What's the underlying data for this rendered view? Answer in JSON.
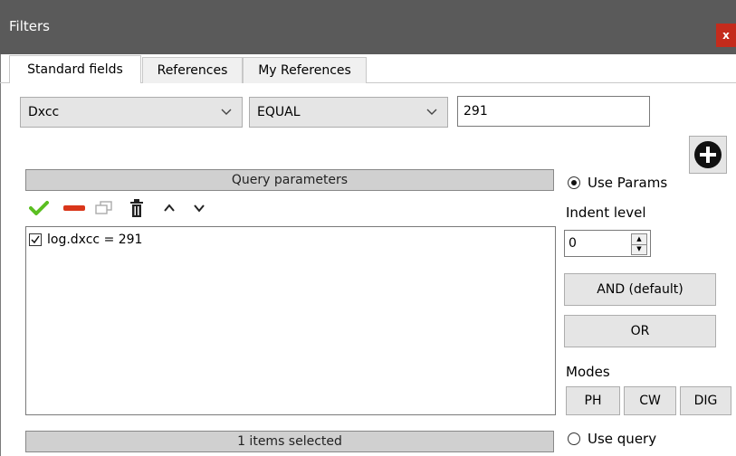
{
  "window": {
    "title": "Filters",
    "close_glyph": "x"
  },
  "tabs": [
    {
      "label": "Standard fields",
      "active": true
    },
    {
      "label": "References",
      "active": false
    },
    {
      "label": "My References",
      "active": false
    }
  ],
  "filter": {
    "field": "Dxcc",
    "operator": "EQUAL",
    "value": "291"
  },
  "query_panel": {
    "header": "Query parameters",
    "toolbar_icons": [
      "check-icon",
      "minus-icon",
      "copy-icon",
      "trash-icon",
      "chevron-up-icon",
      "chevron-down-icon"
    ],
    "items": [
      {
        "text": "log.dxcc = 291",
        "checked": true
      }
    ],
    "status": "1 items selected"
  },
  "options": {
    "use_params_label": "Use Params",
    "use_params_selected": true,
    "indent_label": "Indent level",
    "indent_value": "0",
    "and_label": "AND (default)",
    "or_label": "OR",
    "modes_label": "Modes",
    "mode_buttons": [
      "PH",
      "CW",
      "DIG"
    ],
    "use_query_label": "Use query",
    "use_query_selected": false
  },
  "colors": {
    "titlebar": "#5a5a5a",
    "close": "#c42b1c",
    "check": "#5bbf21",
    "minus": "#d9361a"
  }
}
